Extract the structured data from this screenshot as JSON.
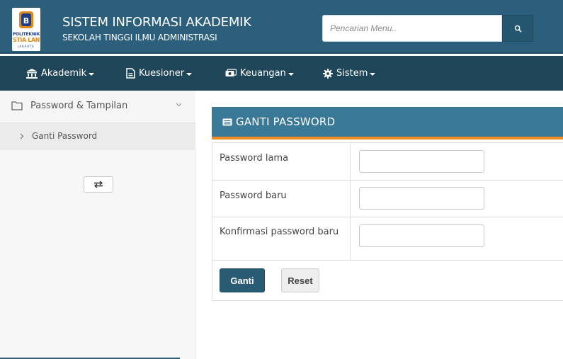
{
  "header": {
    "logo_lines": [
      "POLITEKNIK",
      "STIA LAN",
      "JAKARTA"
    ],
    "title": "SISTEM INFORMASI AKADEMIK",
    "subtitle": "SEKOLAH TINGGI ILMU ADMINISTRASI",
    "search_placeholder": "Pencarian Menu..",
    "search_icon": "search-icon"
  },
  "navbar": {
    "items": [
      {
        "label": "Akademik",
        "icon": "university-icon"
      },
      {
        "label": "Kuesioner",
        "icon": "document-icon"
      },
      {
        "label": "Keuangan",
        "icon": "money-icon"
      },
      {
        "label": "Sistem",
        "icon": "gear-icon"
      }
    ]
  },
  "sidebar": {
    "group_label": "Password & Tampilan",
    "group_icon": "folder-icon",
    "items": [
      {
        "label": "Ganti Password"
      }
    ],
    "toggle_icon": "swap-icon"
  },
  "panel": {
    "title": "GANTI PASSWORD",
    "title_icon": "list-icon",
    "fields": [
      {
        "label": "Password lama",
        "value": ""
      },
      {
        "label": "Password baru",
        "value": ""
      },
      {
        "label": "Konfirmasi password baru",
        "value": ""
      }
    ],
    "submit_label": "Ganti",
    "reset_label": "Reset"
  },
  "colors": {
    "header_bg": "#2b5f7c",
    "navbar_bg": "#1f4558",
    "panel_header_bg": "#3a7898",
    "accent_orange": "#f08a24",
    "button_primary": "#2a5b75"
  }
}
